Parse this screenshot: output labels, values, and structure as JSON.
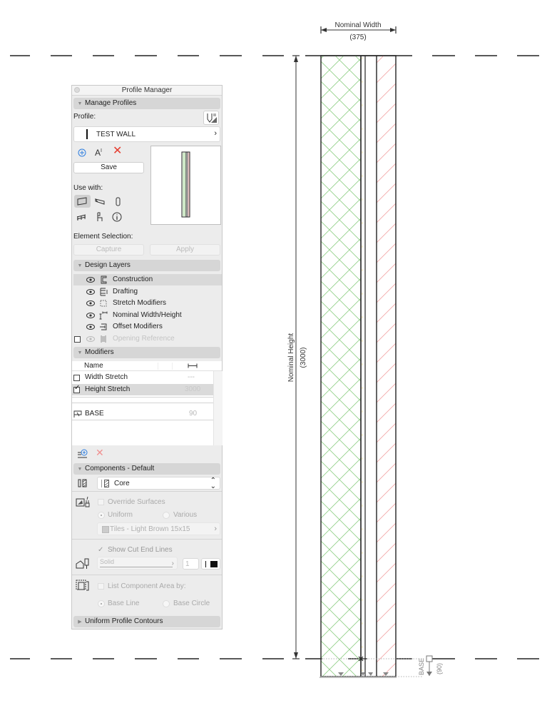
{
  "panel": {
    "title": "Profile Manager",
    "manage_profiles": {
      "header": "Manage Profiles",
      "profile_label": "Profile:",
      "profile_name": "TEST WALL",
      "save_label": "Save",
      "use_with_label": "Use with:",
      "use_with_items": [
        "wall",
        "beam",
        "column",
        "railing",
        "chair-object",
        "info"
      ],
      "element_selection_label": "Element Selection:",
      "capture_label": "Capture",
      "apply_label": "Apply"
    },
    "design_layers": {
      "header": "Design Layers",
      "items": [
        {
          "label": "Construction",
          "visible": true,
          "selected": true,
          "enabled": true
        },
        {
          "label": "Drafting",
          "visible": true,
          "selected": false,
          "enabled": true
        },
        {
          "label": "Stretch Modifiers",
          "visible": true,
          "selected": false,
          "enabled": true
        },
        {
          "label": "Nominal Width/Height",
          "visible": true,
          "selected": false,
          "enabled": true
        },
        {
          "label": "Offset Modifiers",
          "visible": true,
          "selected": false,
          "enabled": true
        },
        {
          "label": "Opening Reference",
          "visible": false,
          "selected": false,
          "enabled": false
        }
      ]
    },
    "modifiers": {
      "header": "Modifiers",
      "col_name": "Name",
      "rows": [
        {
          "checked": false,
          "name": "Width Stretch",
          "value": "---"
        },
        {
          "checked": true,
          "name": "Height Stretch",
          "value": "3000"
        }
      ],
      "offset_rows": [
        {
          "name": "BASE",
          "value": "90"
        }
      ]
    },
    "components": {
      "header": "Components - Default",
      "component_select": "Core",
      "override_surfaces_label": "Override Surfaces",
      "uniform_label": "Uniform",
      "various_label": "Various",
      "surface_value": "Tiles - Light Brown 15x15",
      "show_cut_end_lines_label": "Show Cut End Lines",
      "line_type_value": "Solid",
      "pen_value": "1",
      "list_area_label": "List Component Area by:",
      "base_line_label": "Base Line",
      "base_circle_label": "Base Circle"
    },
    "uniform_profile_contours": {
      "header": "Uniform Profile Contours"
    }
  },
  "drawing": {
    "nominal_width_label": "Nominal Width",
    "nominal_width_value": "(375)",
    "nominal_height_label": "Nominal Height",
    "nominal_height_value": "(3000)",
    "base_label": "BASE",
    "base_value": "(90)",
    "colors": {
      "core_hatch": "#7fc97a",
      "finish_hatch": "#f0a0a0",
      "line": "#222222"
    }
  }
}
